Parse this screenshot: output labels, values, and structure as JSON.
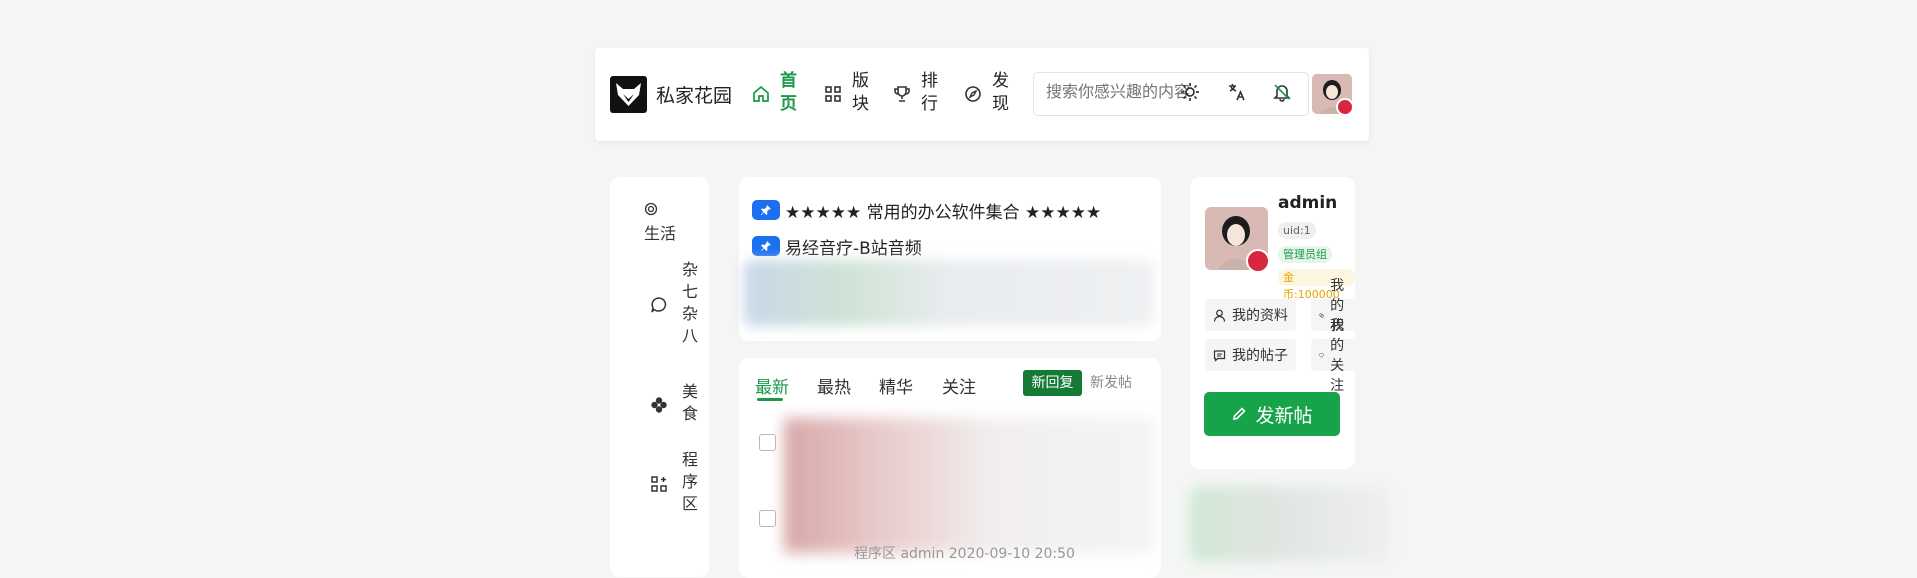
{
  "header": {
    "site_title": "私家花园",
    "nav": [
      {
        "label": "首页",
        "icon": "home-icon",
        "active": true
      },
      {
        "label": "版块",
        "icon": "grid-icon",
        "active": false
      },
      {
        "label": "排行",
        "icon": "trophy-icon",
        "active": false
      },
      {
        "label": "发现",
        "icon": "compass-icon",
        "active": false
      }
    ],
    "search_placeholder": "搜索你感兴趣的内容",
    "icons": [
      "theme-toggle-icon",
      "translate-icon",
      "bell-icon"
    ],
    "accent_color": "#1a9a48"
  },
  "sidebar": {
    "items": [
      {
        "label": "生活",
        "icon": "target-icon"
      },
      {
        "label": "杂七杂八",
        "icon": "chat-bubble-icon"
      },
      {
        "label": "美食",
        "icon": "clover-icon"
      },
      {
        "label": "程序区",
        "icon": "apps-icon"
      }
    ]
  },
  "pinned": {
    "items": [
      {
        "title": "★★★★★ 常用的办公软件集合 ★★★★★"
      },
      {
        "title": "易经音疗-B站音频"
      }
    ]
  },
  "feed": {
    "tabs": [
      "最新",
      "最热",
      "精华",
      "关注"
    ],
    "sort_reply": "新回复",
    "sort_new": "新发帖",
    "meta_text": "程序区    admin   2020-09-10 20:50"
  },
  "profile": {
    "name": "admin",
    "uid": "uid:1",
    "group": "管理员组",
    "coins": "金币:100000",
    "actions": [
      "我的资料",
      "我的积分",
      "我的帖子",
      "我的关注"
    ],
    "post_button": "发新帖"
  }
}
